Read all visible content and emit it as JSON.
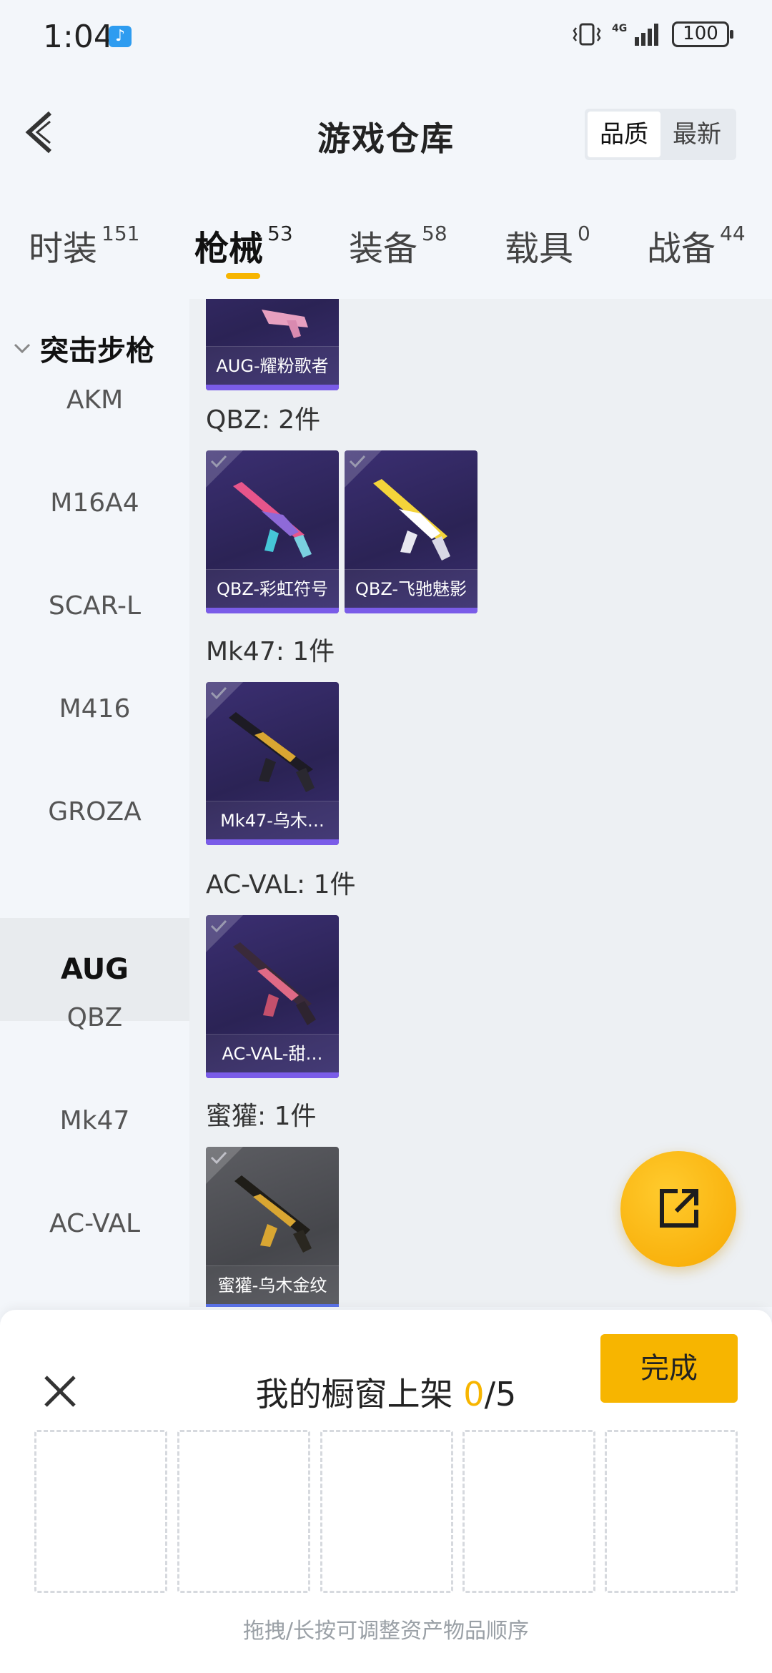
{
  "status_bar": {
    "time": "1:04",
    "network": "4G",
    "battery": "100"
  },
  "header": {
    "title": "游戏仓库",
    "sort_options": [
      "品质",
      "最新"
    ],
    "active_sort": "品质"
  },
  "category_tabs": [
    {
      "label": "时装",
      "count": "151"
    },
    {
      "label": "枪械",
      "count": "53",
      "active": true
    },
    {
      "label": "装备",
      "count": "58"
    },
    {
      "label": "载具",
      "count": "0"
    },
    {
      "label": "战备",
      "count": "44"
    }
  ],
  "sidebar": {
    "group": "突击步枪",
    "items": [
      "AKM",
      "M16A4",
      "SCAR-L",
      "M416",
      "GROZA",
      "AUG",
      "QBZ",
      "Mk47",
      "AC-VAL"
    ],
    "active": "AUG"
  },
  "content": {
    "top_card": {
      "name": "AUG-耀粉歌者"
    },
    "sections": [
      {
        "label": "QBZ: 2件",
        "items": [
          {
            "name": "QBZ-彩虹符号",
            "accent": "#e7558b"
          },
          {
            "name": "QBZ-飞驰魅影",
            "accent": "#f4d43a"
          }
        ]
      },
      {
        "label": "Mk47: 1件",
        "items": [
          {
            "name": "Mk47-乌木…",
            "accent": "#d9a632"
          }
        ]
      },
      {
        "label": "AC-VAL: 1件",
        "items": [
          {
            "name": "AC-VAL-甜…",
            "accent": "#e06a86"
          }
        ]
      },
      {
        "label": "蜜獾: 1件",
        "items": [
          {
            "name": "蜜獾-乌木金纹",
            "accent": "#d9a632"
          }
        ]
      }
    ]
  },
  "share_fab": {
    "icon": "share-icon"
  },
  "bottom_panel": {
    "title": "我的橱窗上架",
    "count_now": "0",
    "count_total": "/5",
    "done_label": "完成",
    "hint": "拖拽/长按可调整资产物品顺序",
    "slots": 5
  },
  "colors": {
    "accent": "#f7b500",
    "card_purple": "#2b2355",
    "card_grey": "#46474c"
  }
}
